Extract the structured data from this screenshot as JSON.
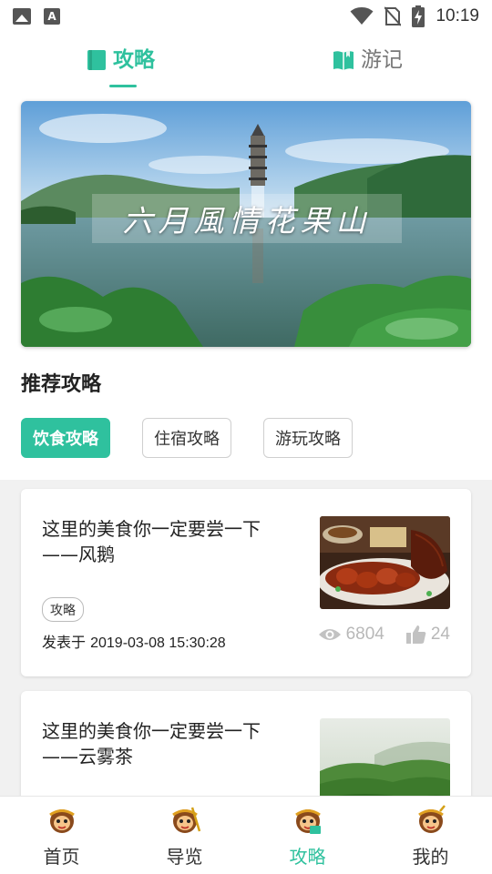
{
  "status_bar": {
    "time": "10:19",
    "left_icons": [
      "image-icon",
      "font-a-icon"
    ],
    "right_icons": [
      "wifi-icon",
      "no-sim-icon",
      "battery-charging-icon"
    ]
  },
  "tabs": [
    {
      "label": "攻略",
      "icon": "book-icon",
      "active": true
    },
    {
      "label": "游记",
      "icon": "open-book-icon",
      "active": false
    }
  ],
  "banner": {
    "title": "六月風情花果山"
  },
  "section": {
    "title": "推荐攻略"
  },
  "categories": [
    {
      "label": "饮食攻略",
      "active": true
    },
    {
      "label": "住宿攻略",
      "active": false
    },
    {
      "label": "游玩攻略",
      "active": false
    }
  ],
  "articles": [
    {
      "title": "这里的美食你一定要尝一下——风鹅",
      "tag": "攻略",
      "date_prefix": "发表于",
      "date": "2019-03-08 15:30:28",
      "views": "6804",
      "likes": "24"
    },
    {
      "title": "这里的美食你一定要尝一下——云雾茶"
    }
  ],
  "bottom_nav": [
    {
      "label": "首页",
      "icon": "monkey-king-icon",
      "active": false
    },
    {
      "label": "导览",
      "icon": "monkey-king-icon",
      "active": false
    },
    {
      "label": "攻略",
      "icon": "monkey-king-icon",
      "active": true
    },
    {
      "label": "我的",
      "icon": "monkey-king-icon",
      "active": false
    }
  ],
  "colors": {
    "accent": "#2fc19e",
    "background": "#ffffff",
    "list_background": "#f1f1f1",
    "muted": "#b8b8b8"
  }
}
